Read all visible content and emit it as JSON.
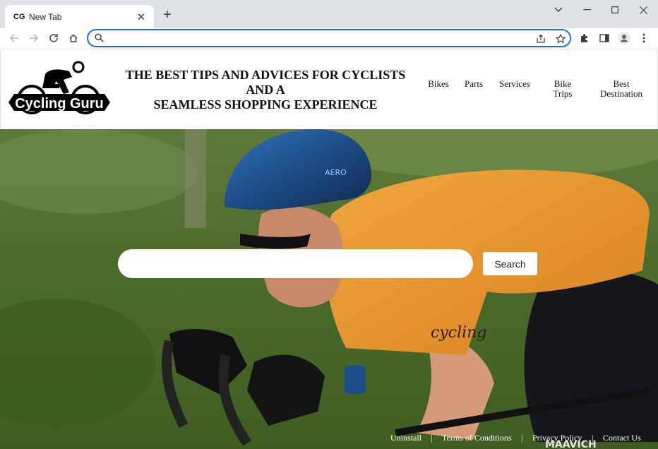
{
  "browser": {
    "tab": {
      "favicon_text": "CG",
      "title": "New Tab"
    },
    "address_bar": {
      "value": "",
      "placeholder": ""
    }
  },
  "site": {
    "logo_text": "Cycling Guru",
    "tagline": [
      "THE BEST TIPS AND ADVICES FOR CYCLISTS",
      "AND A",
      "SEAMLESS SHOPPING EXPERIENCE"
    ],
    "nav": [
      {
        "label_lines": [
          "Bikes"
        ]
      },
      {
        "label_lines": [
          "Parts"
        ]
      },
      {
        "label_lines": [
          "Services"
        ]
      },
      {
        "label_lines": [
          "Bike",
          "Trips"
        ]
      },
      {
        "label_lines": [
          "Best",
          "Destination"
        ]
      }
    ]
  },
  "hero": {
    "search_button": "Search",
    "search_value": "",
    "jersey_text": "cycling",
    "helmet_text": "AERO",
    "watermark": "MAAVICH"
  },
  "footer": {
    "links": [
      "Uninstall",
      "Terms of Conditions",
      "Privacy Policy",
      "Contact Us"
    ],
    "separator": "|"
  },
  "colors": {
    "accent": "#1a73e8",
    "tabbar": "#dee1e6",
    "jersey": "#e8962c",
    "helmet": "#1f4f8a"
  }
}
